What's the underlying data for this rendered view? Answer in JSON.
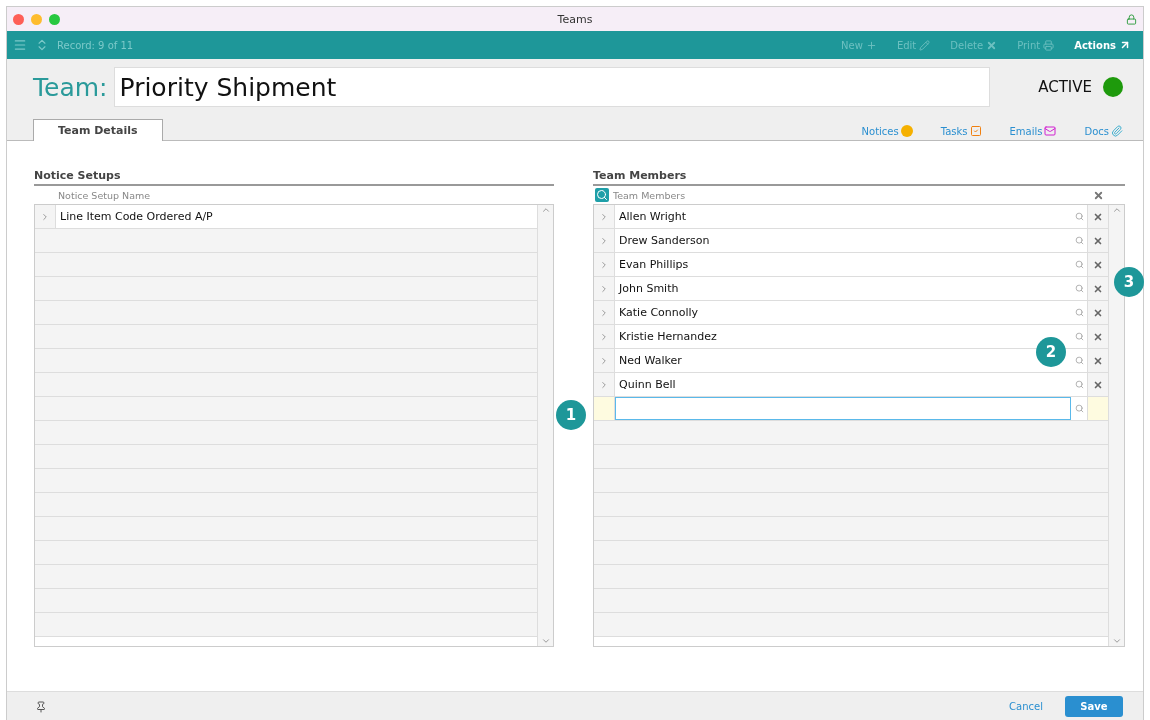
{
  "window": {
    "title": "Teams"
  },
  "toolbar": {
    "record": "Record: 9 of 11",
    "actions": [
      {
        "label": "New",
        "kind": "new",
        "disabled": true
      },
      {
        "label": "Edit",
        "kind": "edit",
        "disabled": true
      },
      {
        "label": "Delete",
        "kind": "delete",
        "disabled": true
      },
      {
        "label": "Print",
        "kind": "print",
        "disabled": true
      },
      {
        "label": "Actions",
        "kind": "actions",
        "disabled": false
      }
    ]
  },
  "header": {
    "label": "Team:",
    "name": "Priority Shipment",
    "status": "ACTIVE"
  },
  "tabs": [
    {
      "label": "Team Details",
      "selected": true
    }
  ],
  "links": [
    {
      "label": "Notices",
      "kind": "notices"
    },
    {
      "label": "Tasks",
      "kind": "tasks"
    },
    {
      "label": "Emails",
      "kind": "emails"
    },
    {
      "label": "Docs",
      "kind": "docs"
    }
  ],
  "notice_setups": {
    "title": "Notice Setups",
    "column": "Notice Setup Name",
    "rows": [
      "Line Item Code Ordered A/P"
    ]
  },
  "team_members": {
    "title": "Team Members",
    "column": "Team Members",
    "rows": [
      "Allen Wright",
      "Drew Sanderson",
      "Evan Phillips",
      "John Smith",
      "Katie Connolly",
      "Kristie Hernandez",
      "Ned Walker",
      "Quinn Bell"
    ]
  },
  "callouts": [
    {
      "label": "1"
    },
    {
      "label": "2"
    },
    {
      "label": "3"
    }
  ],
  "footer": {
    "cancel": "Cancel",
    "save": "Save"
  }
}
